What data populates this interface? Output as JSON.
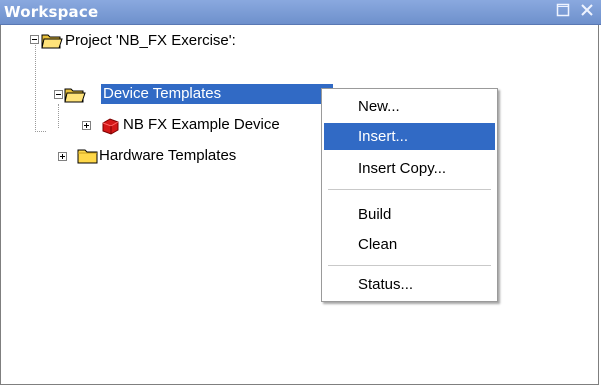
{
  "window": {
    "title": "Workspace",
    "restore_icon": "restore-icon",
    "close_icon": "close-icon"
  },
  "tree": {
    "project": {
      "label": "Project 'NB_FX Exercise':",
      "expanded": true,
      "icon": "open-folder-icon"
    },
    "device_templates": {
      "label": "Device Templates",
      "expanded": true,
      "selected": true,
      "icon": "open-folder-icon"
    },
    "device_example": {
      "label": "NB FX Example Device",
      "expanded": false,
      "icon": "red-device-icon"
    },
    "hardware_templates": {
      "label": "Hardware Templates",
      "expanded": false,
      "icon": "folder-icon"
    }
  },
  "context_menu": {
    "items": [
      {
        "label": "New...",
        "highlighted": false
      },
      {
        "label": "Insert...",
        "highlighted": true
      },
      {
        "label": "Insert Copy...",
        "highlighted": false
      },
      {
        "label": "Build",
        "highlighted": false
      },
      {
        "label": "Clean",
        "highlighted": false
      },
      {
        "label": "Status...",
        "highlighted": false
      }
    ]
  },
  "colors": {
    "titlebar": "#7f9fd6",
    "selection": "#316ac5",
    "folder": "#ffd84a"
  }
}
